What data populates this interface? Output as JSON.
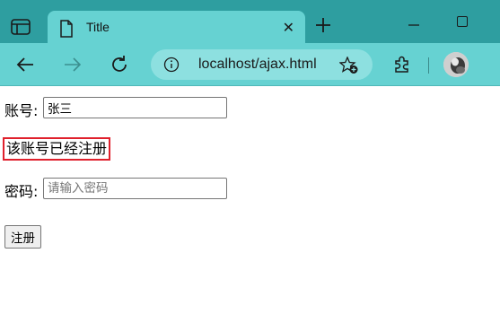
{
  "browser": {
    "tab_title": "Title",
    "tab_close_glyph": "✕",
    "address_url": "localhost/ajax.html",
    "toolbar_color": "#66d2d2",
    "titlebar_color": "#2e9ea0"
  },
  "form": {
    "account_label": "账号:",
    "account_value": "张三",
    "message": "该账号已经注册",
    "message_border_color": "#e0202c",
    "password_label": "密码:",
    "password_placeholder": "请输入密码",
    "submit_label": "注册"
  }
}
